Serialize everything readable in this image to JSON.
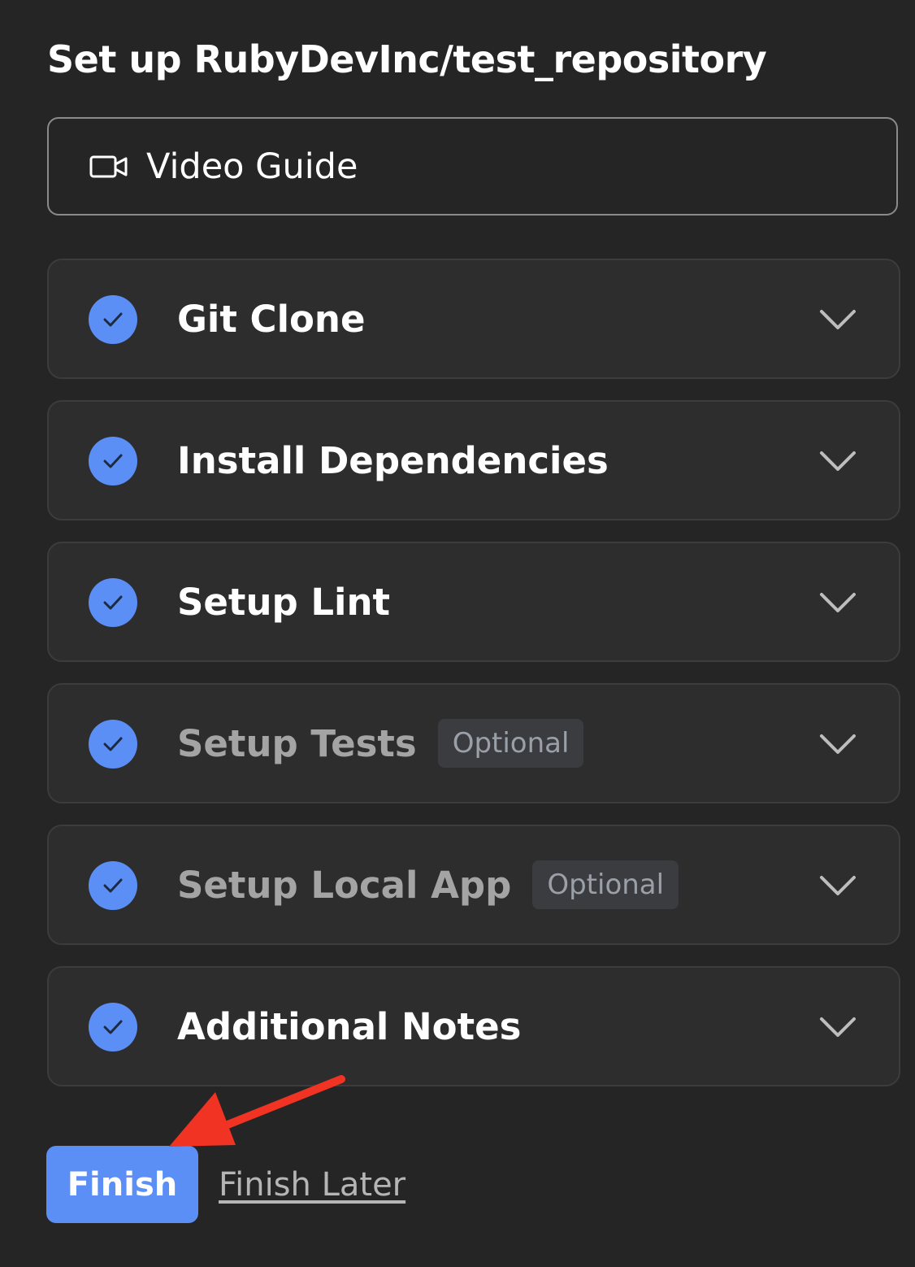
{
  "header": {
    "title": "Set up RubyDevInc/test_repository"
  },
  "video_guide": {
    "label": "Video Guide",
    "icon": "video-camera-icon"
  },
  "steps": [
    {
      "label": "Git Clone",
      "completed": true,
      "optional": false
    },
    {
      "label": "Install Dependencies",
      "completed": true,
      "optional": false
    },
    {
      "label": "Setup Lint",
      "completed": true,
      "optional": false
    },
    {
      "label": "Setup Tests",
      "completed": true,
      "optional": true,
      "badge": "Optional"
    },
    {
      "label": "Setup Local App",
      "completed": true,
      "optional": true,
      "badge": "Optional"
    },
    {
      "label": "Additional Notes",
      "completed": true,
      "optional": false
    }
  ],
  "footer": {
    "finish_label": "Finish",
    "finish_later_label": "Finish Later"
  },
  "colors": {
    "background": "#252526",
    "accent": "#5b8ff5",
    "annotation_arrow": "#f03323"
  }
}
